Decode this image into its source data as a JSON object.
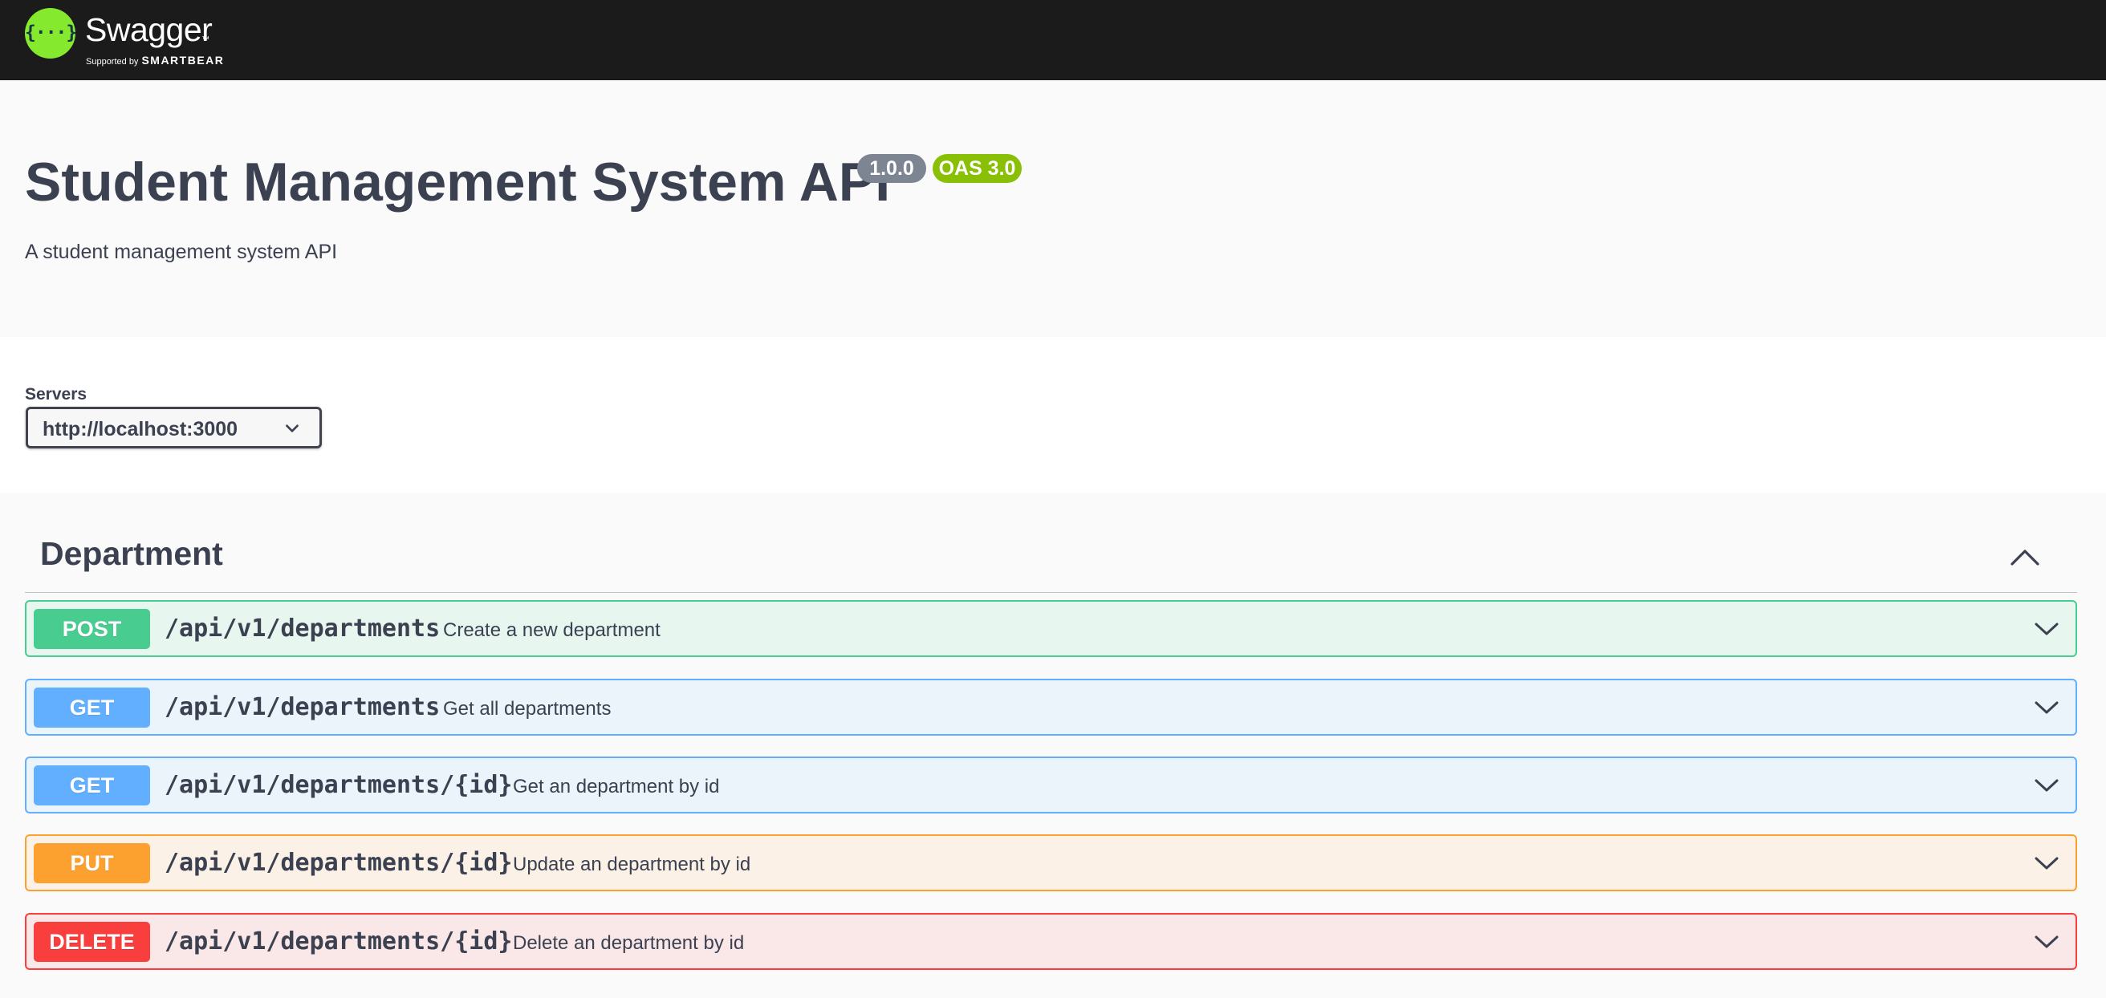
{
  "topbar": {
    "brand_name": "Swagger",
    "brand_tm": "™",
    "supported_by": "Supported by",
    "supporter": "SMARTBEAR",
    "logo_glyph": "{···}",
    "logo_color": "#85ea2d"
  },
  "info": {
    "title": "Student Management System API",
    "version_badge": "1.0.0",
    "oas_badge": "OAS 3.0",
    "description": "A student management system API"
  },
  "servers": {
    "label": "Servers",
    "selected": "http://localhost:3000"
  },
  "tag": {
    "name": "Department",
    "expanded": true
  },
  "operations": [
    {
      "method": "POST",
      "path": "/api/v1/departments",
      "summary": "Create a new department",
      "color": "#49cc90"
    },
    {
      "method": "GET",
      "path": "/api/v1/departments",
      "summary": "Get all departments",
      "color": "#61affe"
    },
    {
      "method": "GET",
      "path": "/api/v1/departments/{id}",
      "summary": "Get an department by id",
      "color": "#61affe"
    },
    {
      "method": "PUT",
      "path": "/api/v1/departments/{id}",
      "summary": "Update an department by id",
      "color": "#fca130"
    },
    {
      "method": "DELETE",
      "path": "/api/v1/departments/{id}",
      "summary": "Delete an department by id",
      "color": "#f93e3e"
    }
  ]
}
